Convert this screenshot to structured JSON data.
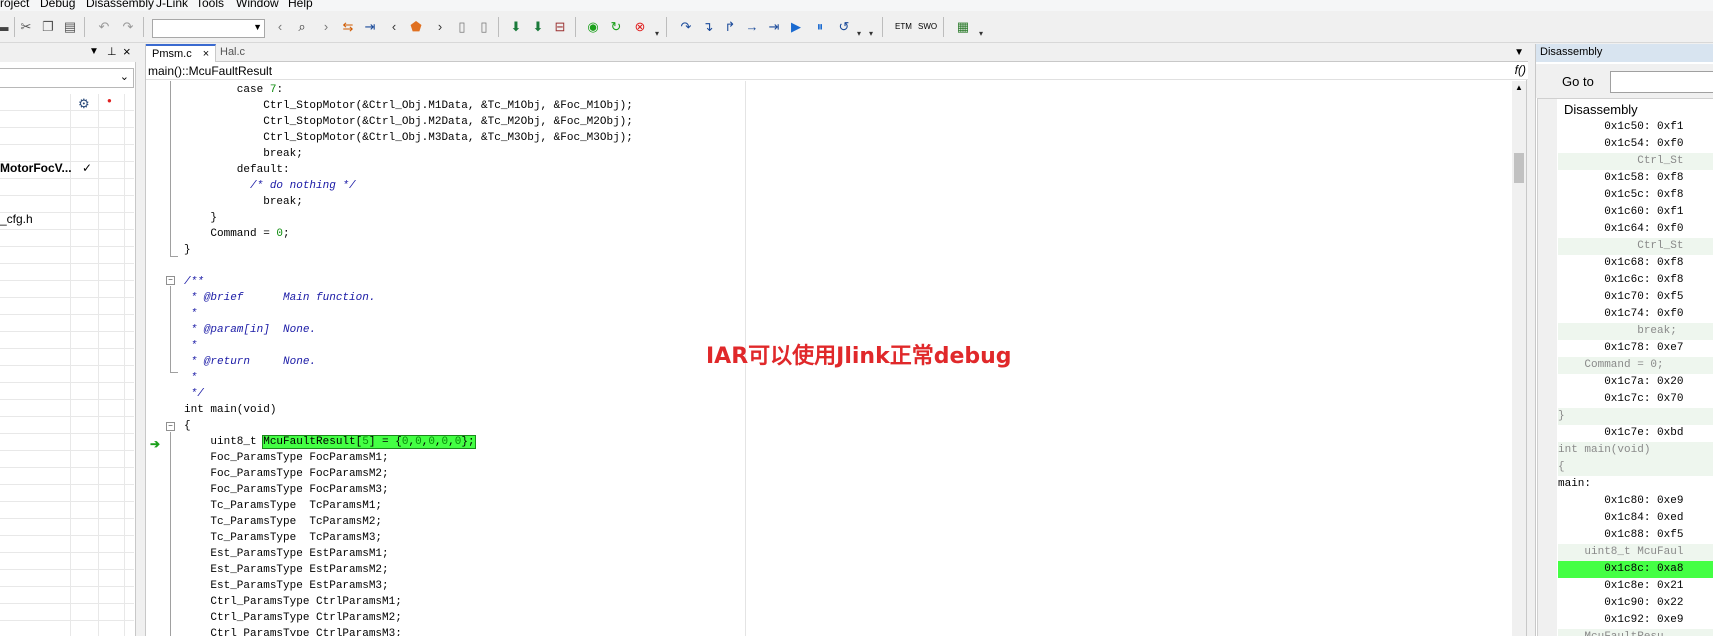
{
  "menubar": {
    "items": [
      "roject",
      "Debug",
      "Disassembly",
      "J-Link",
      "Tools",
      "Window",
      "Help"
    ]
  },
  "toolbar": {
    "combo_value": "",
    "etm_label": "ETM",
    "swo_label": "SWO"
  },
  "editor": {
    "tabs": [
      {
        "label": "Pmsm.c",
        "active": true,
        "close": "×"
      },
      {
        "label": "Hal.c",
        "active": false
      }
    ],
    "breadcrumb": "main()::McuFaultResult",
    "func_icon": "f()",
    "code_lines": [
      "        case 7:",
      "            Ctrl_StopMotor(&Ctrl_Obj.M1Data, &Tc_M1Obj, &Foc_M1Obj);",
      "            Ctrl_StopMotor(&Ctrl_Obj.M2Data, &Tc_M2Obj, &Foc_M2Obj);",
      "            Ctrl_StopMotor(&Ctrl_Obj.M3Data, &Tc_M3Obj, &Foc_M3Obj);",
      "            break;",
      "        default:",
      "          /* do nothing */",
      "            break;",
      "    }",
      "    Command = 0;",
      "}",
      "",
      "/**",
      " * @brief      Main function.",
      " *",
      " * @param[in]  None.",
      " *",
      " * @return     None.",
      " *",
      " */",
      "int main(void)",
      "{",
      "    uint8_t McuFaultResult[5] = {0,0,0,0,0};",
      "    Foc_ParamsType FocParamsM1;",
      "    Foc_ParamsType FocParamsM2;",
      "    Foc_ParamsType FocParamsM3;",
      "    Tc_ParamsType  TcParamsM1;",
      "    Tc_ParamsType  TcParamsM2;",
      "    Tc_ParamsType  TcParamsM3;",
      "    Est_ParamsType EstParamsM1;",
      "    Est_ParamsType EstParamsM2;",
      "    Est_ParamsType EstParamsM3;",
      "    Ctrl_ParamsType CtrlParamsM1;",
      "    Ctrl_ParamsType CtrlParamsM2;",
      "    Ctrl_ParamsType CtrlParamsM3;"
    ],
    "current_line_index": 22
  },
  "left_panel": {
    "files": [
      "MotorFocV...",
      "_cfg.h"
    ],
    "check": "✓",
    "gear": "⚙",
    "dot": "●"
  },
  "overlay_text": "IAR可以使用Jlink正常debug",
  "disassembly": {
    "title": "Disassembly",
    "goto_label": "Go to",
    "goto_value": "",
    "list_header": "Disassembly",
    "lines": [
      {
        "text": "       0x1c50: 0xf1",
        "kind": "asm"
      },
      {
        "text": "       0x1c54: 0xf0",
        "kind": "asm"
      },
      {
        "text": "            Ctrl_St",
        "kind": "src"
      },
      {
        "text": "       0x1c58: 0xf8",
        "kind": "asm"
      },
      {
        "text": "       0x1c5c: 0xf8",
        "kind": "asm"
      },
      {
        "text": "       0x1c60: 0xf1",
        "kind": "asm"
      },
      {
        "text": "       0x1c64: 0xf0",
        "kind": "asm"
      },
      {
        "text": "            Ctrl_St",
        "kind": "src"
      },
      {
        "text": "       0x1c68: 0xf8",
        "kind": "asm"
      },
      {
        "text": "       0x1c6c: 0xf8",
        "kind": "asm"
      },
      {
        "text": "       0x1c70: 0xf5",
        "kind": "asm"
      },
      {
        "text": "       0x1c74: 0xf0",
        "kind": "asm"
      },
      {
        "text": "            break;",
        "kind": "src"
      },
      {
        "text": "       0x1c78: 0xe7",
        "kind": "asm"
      },
      {
        "text": "    Command = 0;",
        "kind": "src"
      },
      {
        "text": "       0x1c7a: 0x20",
        "kind": "asm"
      },
      {
        "text": "       0x1c7c: 0x70",
        "kind": "asm"
      },
      {
        "text": "}",
        "kind": "src"
      },
      {
        "text": "       0x1c7e: 0xbd",
        "kind": "asm"
      },
      {
        "text": "int main(void)",
        "kind": "src"
      },
      {
        "text": "{",
        "kind": "src"
      },
      {
        "text": "main:",
        "kind": "label"
      },
      {
        "text": "       0x1c80: 0xe9",
        "kind": "asm"
      },
      {
        "text": "       0x1c84: 0xed",
        "kind": "asm"
      },
      {
        "text": "       0x1c88: 0xf5",
        "kind": "asm"
      },
      {
        "text": "    uint8_t McuFaul",
        "kind": "src"
      },
      {
        "text": "       0x1c8c: 0xa8",
        "kind": "cur"
      },
      {
        "text": "       0x1c8e: 0x21",
        "kind": "asm"
      },
      {
        "text": "       0x1c90: 0x22",
        "kind": "asm"
      },
      {
        "text": "       0x1c92: 0xe9",
        "kind": "asm"
      },
      {
        "text": "    McuFaultResu",
        "kind": "src"
      }
    ]
  },
  "colors": {
    "current_line": "#44ff44",
    "comment": "#1a1aa6",
    "number": "#0a8a0a",
    "overlay": "#e0282a"
  }
}
